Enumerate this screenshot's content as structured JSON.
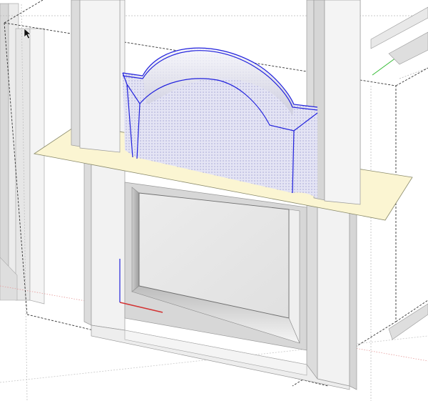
{
  "app": {
    "name": "",
    "tool": "select"
  },
  "viewport": {
    "background": "#ffffff",
    "model": "cabinet-door-raised-panel",
    "colors": {
      "frame_face": "#f1f1f1",
      "frame_side": "#dadada",
      "panel_fill": "#ecebed",
      "selection_fill": "#e2e3f3",
      "selection_edge": "#2222dd",
      "section_plane": "#fbf5d2",
      "section_edge": "#888866",
      "bbox_edge": "#333333",
      "axis_red": "#d33333",
      "axis_green": "#33bb33",
      "axis_blue": "#3333dd"
    }
  }
}
